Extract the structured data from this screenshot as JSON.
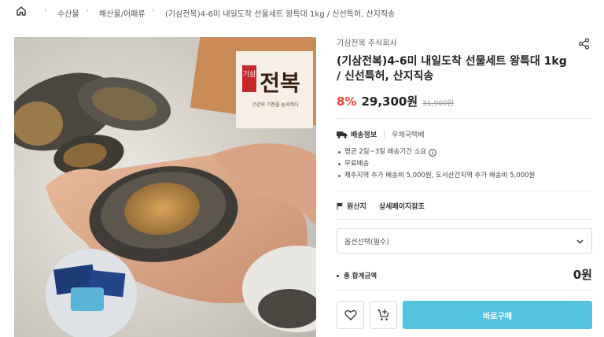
{
  "breadcrumb": {
    "home_icon": "home-icon",
    "items": [
      "수산물",
      "해산물/어패류",
      "(기삼전복)4-6미 내일도착 선물세트 왕특대 1kg / 신선특허, 산지직송"
    ]
  },
  "product": {
    "image_desc_icon": "abalone-product-photo",
    "logo_text": {
      "small": "기삼",
      "big": "전복",
      "tagline": "건강의 기준을 높여주다"
    },
    "seller": "기삼전복 주식회사",
    "title": "(기삼전복)4-6미 내일도착 선물세트 왕특대 1kg / 신선특허, 산지직송",
    "discount": "8%",
    "price": "29,300원",
    "original_price": "31,900원"
  },
  "shipping": {
    "label": "배송정보",
    "value": "우체국택배",
    "details": [
      "평균 2일~3일 배송기간 소요",
      "무료배송",
      "제주지역 추가 배송비 5,000원, 도서산간지역 추가 배송비 5,000원"
    ]
  },
  "origin": {
    "label": "원산지",
    "value": "상세페이지참조"
  },
  "option": {
    "placeholder": "옵션선택(필수)"
  },
  "total": {
    "label": "총 합계금액",
    "value": "0원"
  },
  "actions": {
    "buy_label": "바로구매"
  },
  "colors": {
    "accent": "#55c3df",
    "discount": "#e8443c"
  }
}
